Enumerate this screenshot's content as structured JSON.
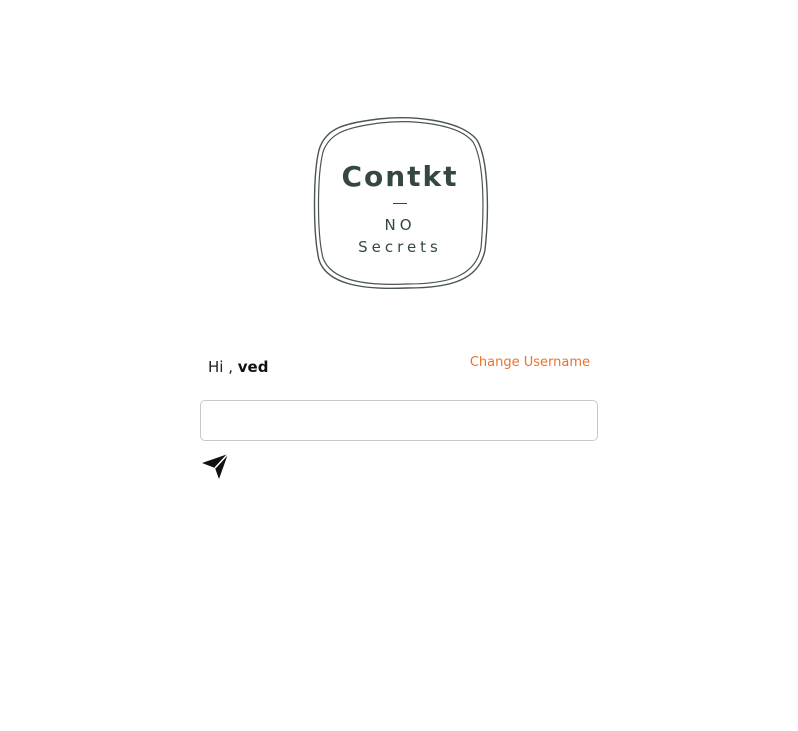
{
  "logo": {
    "title": "Contkt",
    "line1": "NO",
    "line2": "Secrets"
  },
  "greeting": {
    "prefix": "Hi ,",
    "username": "ved"
  },
  "change_username": {
    "label": "Change Username"
  },
  "message_input": {
    "value": "",
    "placeholder": ""
  },
  "send_button": {
    "icon": "paper-plane-icon"
  },
  "colors": {
    "logo_text": "#354840",
    "link": "#e8732a",
    "input_border": "#c9c9c9"
  }
}
